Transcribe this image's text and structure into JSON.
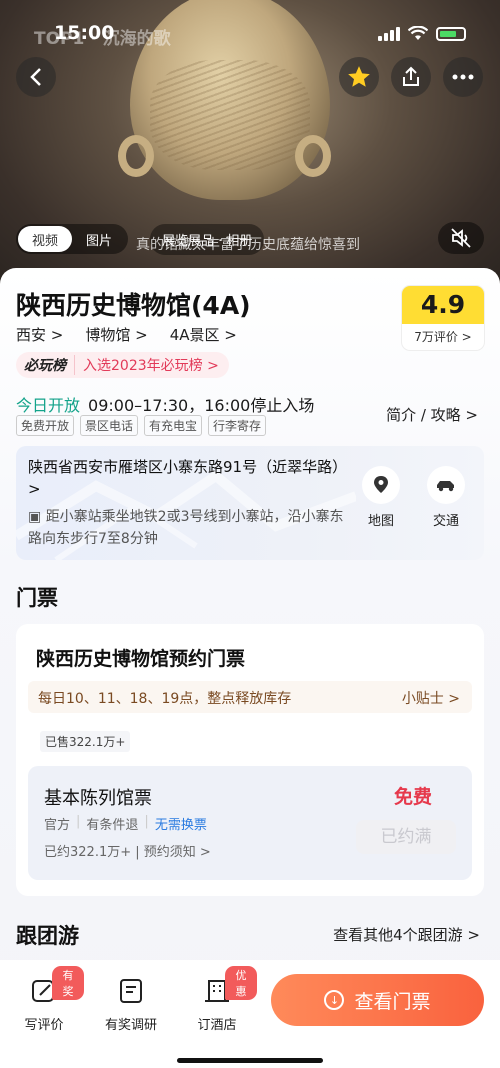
{
  "status_bar": {
    "time": "15:00",
    "overlay_text": "TOP1 · 沉海的歌"
  },
  "media": {
    "tabs": [
      {
        "label": "视频",
        "active": true
      },
      {
        "label": "图片",
        "active": false
      }
    ],
    "pill_text": "展览展品 · 相册",
    "caption": "真的馆藏太丰富了历史底蕴给惊喜到"
  },
  "header": {
    "title": "陕西历史博物馆(4A)",
    "breadcrumbs": [
      "西安 >",
      "博物馆 >",
      "4A景区 >"
    ],
    "rating": {
      "score": "4.9",
      "count": "7万评价 >"
    },
    "rank": {
      "logo": "必玩榜",
      "text": "入选2023年必玩榜 >"
    }
  },
  "hours": {
    "status": "今日开放",
    "time": "09:00–17:30，16:00停止入场",
    "intro_link": "简介 / 攻略 >",
    "tags": [
      "免费开放",
      "景区电话",
      "有充电宝",
      "行李寄存"
    ]
  },
  "address": {
    "line": "陕西省西安市雁塔区小寨东路91号（近翠华路）>",
    "metro": "距小寨站乘坐地铁2或3号线到小寨站，沿小寨东路向东步行7至8分钟",
    "actions": [
      {
        "label": "地图",
        "icon": "map-pin-icon"
      },
      {
        "label": "交通",
        "icon": "car-icon"
      }
    ]
  },
  "tickets": {
    "section_title": "门票",
    "card_title": "陕西历史博物馆预约门票",
    "notice": "每日10、11、18、19点，整点释放库存",
    "tip": "小贴士 >",
    "sold": "已售322.1万+",
    "product": {
      "name": "基本陈列馆票",
      "meta": [
        "官方",
        "有条件退",
        "无需换票"
      ],
      "booked": "已约322.1万+ | 预约须知 >",
      "price": "免费",
      "button": "已约满"
    }
  },
  "group_tour": {
    "section_title": "跟团游",
    "more": "查看其他4个跟团游 >"
  },
  "bottom_bar": {
    "items": [
      {
        "label": "写评价",
        "badge": "有奖"
      },
      {
        "label": "有奖调研",
        "badge": ""
      },
      {
        "label": "订酒店",
        "badge": "优惠"
      }
    ],
    "cta": "查看门票"
  },
  "colors": {
    "accent_green": "#13a38a",
    "price_red": "#e6394c",
    "rating_yellow": "#ffdd33",
    "cta_orange": "#f9623e"
  }
}
